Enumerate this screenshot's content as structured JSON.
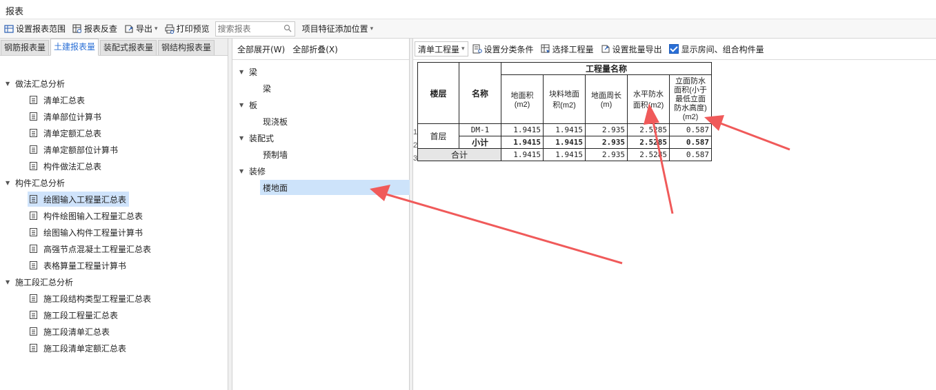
{
  "window": {
    "title": "报表"
  },
  "toolbar": {
    "set_range": "设置报表范围",
    "check": "报表反查",
    "export": "导出",
    "print_preview": "打印预览",
    "search_placeholder": "搜索报表",
    "feature_position": "项目特征添加位置"
  },
  "left_tabs": [
    "钢筋报表量",
    "土建报表量",
    "装配式报表量",
    "钢结构报表量"
  ],
  "left_tree": {
    "g1": "做法汇总分析",
    "g1_items": [
      "清单汇总表",
      "清单部位计算书",
      "清单定额汇总表",
      "清单定额部位计算书",
      "构件做法汇总表"
    ],
    "g2": "构件汇总分析",
    "g2_items": [
      "绘图输入工程量汇总表",
      "构件绘图输入工程量汇总表",
      "绘图输入构件工程量计算书",
      "高强节点混凝土工程量汇总表",
      "表格算量工程量计算书"
    ],
    "g3": "施工段汇总分析",
    "g3_items": [
      "施工段结构类型工程量汇总表",
      "施工段工程量汇总表",
      "施工段清单汇总表",
      "施工段清单定额汇总表"
    ]
  },
  "mid": {
    "expand_all": "全部展开(W)",
    "collapse_all": "全部折叠(X)",
    "nodes": [
      {
        "label": "梁",
        "child": "梁"
      },
      {
        "label": "板",
        "child": "现浇板"
      },
      {
        "label": "装配式",
        "child": "预制墙"
      },
      {
        "label": "装修",
        "child": "楼地面"
      }
    ]
  },
  "right_toolbar": {
    "qty_type": "清单工程量",
    "set_category": "设置分类条件",
    "select_qty": "选择工程量",
    "batch_export": "设置批量导出",
    "show_rooms": "显示房间、组合构件量"
  },
  "table": {
    "h_floor": "楼层",
    "h_name": "名称",
    "h_group": "工程量名称",
    "cols": [
      "地面积(m2)",
      "块料地面积(m2)",
      "地面周长(m)",
      "水平防水面积(m2)",
      "立面防水面积(小于最低立面防水高度)(m2)"
    ],
    "row_numbers": [
      "1",
      "2",
      "3"
    ],
    "floor_1": "首层",
    "r1_name": "DM-1",
    "r1": [
      "1.9415",
      "1.9415",
      "2.935",
      "2.5285",
      "0.587"
    ],
    "r2_name": "小计",
    "r2": [
      "1.9415",
      "1.9415",
      "2.935",
      "2.5285",
      "0.587"
    ],
    "r3_name": "合计",
    "r3": [
      "1.9415",
      "1.9415",
      "2.935",
      "2.5285",
      "0.587"
    ]
  },
  "colors": {
    "accent": "#2a6fd6",
    "selection": "#cfe3fb",
    "arrow": "#f05a5a"
  }
}
